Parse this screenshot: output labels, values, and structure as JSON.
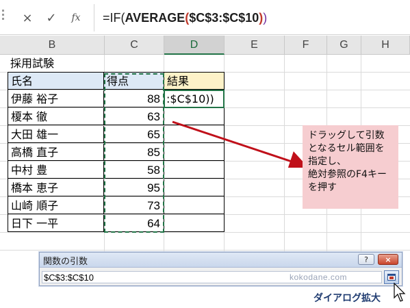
{
  "formula_bar": {
    "cancel_icon": "×",
    "enter_icon": "✓",
    "fx_label": "fx",
    "formula_parts": {
      "p1": "=IF(",
      "p2": "AVERAGE",
      "p3": "(",
      "p4": "$C$3:$C$10",
      "p5": ")",
      "p6": ")"
    }
  },
  "columns": [
    {
      "id": "B",
      "label": "B",
      "selected": false
    },
    {
      "id": "C",
      "label": "C",
      "selected": false
    },
    {
      "id": "D",
      "label": "D",
      "selected": true
    },
    {
      "id": "E",
      "label": "E",
      "selected": false
    },
    {
      "id": "F",
      "label": "F",
      "selected": false
    },
    {
      "id": "G",
      "label": "G",
      "selected": false
    },
    {
      "id": "H",
      "label": "H",
      "selected": false
    }
  ],
  "sheet": {
    "title": "採用試験",
    "headers": {
      "name": "氏名",
      "score": "得点",
      "result": "結果"
    },
    "rows": [
      {
        "name": "伊藤 裕子",
        "score": "88",
        "result": ":$C$10))"
      },
      {
        "name": "榎本 徹",
        "score": "63",
        "result": ""
      },
      {
        "name": "大田 雄一",
        "score": "65",
        "result": ""
      },
      {
        "name": "高橋 直子",
        "score": "85",
        "result": ""
      },
      {
        "name": "中村 豊",
        "score": "58",
        "result": ""
      },
      {
        "name": "橋本 恵子",
        "score": "95",
        "result": ""
      },
      {
        "name": "山崎 順子",
        "score": "73",
        "result": ""
      },
      {
        "name": "日下 一平",
        "score": "64",
        "result": ""
      }
    ]
  },
  "callout": {
    "lines": [
      "ドラッグして引数",
      "となるセル範囲を",
      "指定し、",
      "絶対参照のF4キー",
      "を押す"
    ]
  },
  "dialog": {
    "title": "関数の引数",
    "help_label": "?",
    "close_label": "×",
    "input_value": "$C$3:$C$10",
    "watermark": "kokodane.com"
  },
  "caption": "ダイアログ拡大",
  "colors": {
    "accent_green": "#217346",
    "formula_red": "#c0392b",
    "arrow_red": "#c0101a",
    "callout_bg": "#f6cdd0"
  }
}
